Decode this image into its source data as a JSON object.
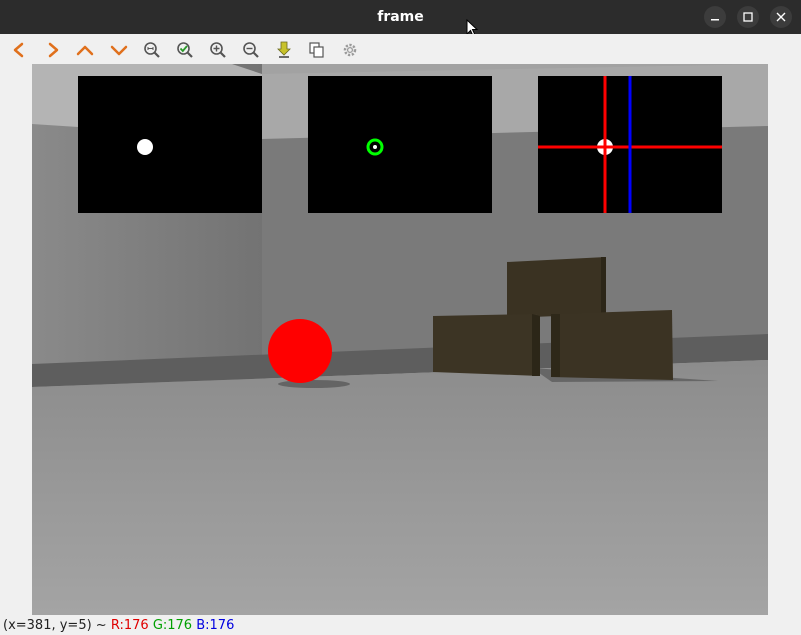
{
  "window": {
    "title": "frame"
  },
  "toolbar": {
    "buttons": [
      {
        "name": "back-icon"
      },
      {
        "name": "forward-icon"
      },
      {
        "name": "chevron-up-icon"
      },
      {
        "name": "chevron-down-icon"
      },
      {
        "name": "zoom-fit-icon"
      },
      {
        "name": "zoom-ok-icon"
      },
      {
        "name": "zoom-in-icon"
      },
      {
        "name": "zoom-out-icon"
      },
      {
        "name": "save-icon"
      },
      {
        "name": "copy-icon"
      },
      {
        "name": "settings-icon"
      }
    ]
  },
  "colors": {
    "ball": "#ff0000",
    "contour": "#00ff00",
    "crosshair_red": "#ff0000",
    "crosshair_blue": "#0000ff",
    "accent_orange": "#e0701c"
  },
  "status": {
    "coords": "(x=381, y=5) ~",
    "r": "R:176",
    "g": "G:176",
    "b": "B:176"
  }
}
